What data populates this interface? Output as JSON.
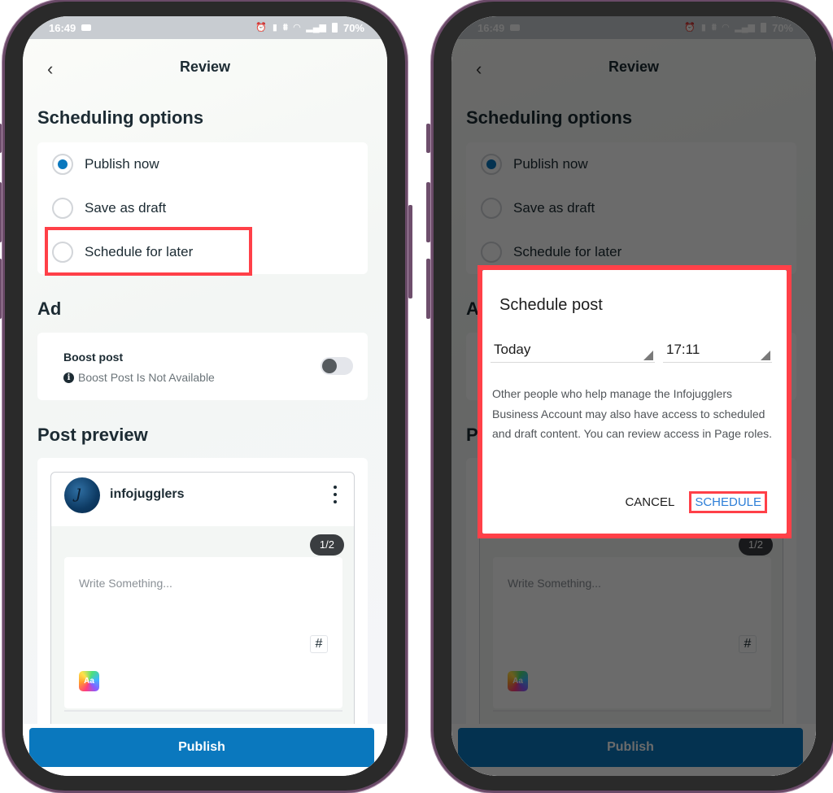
{
  "status_bar": {
    "time": "16:49",
    "battery": "70%",
    "icons": [
      "gallery-icon",
      "alarm-icon",
      "vibrate-icon",
      "volte-icon",
      "wifi-icon",
      "signal-icon",
      "battery-icon"
    ]
  },
  "header": {
    "back_icon": "chevron-left-icon",
    "title": "Review"
  },
  "scheduling": {
    "title": "Scheduling options",
    "options": [
      {
        "label": "Publish now",
        "selected": true
      },
      {
        "label": "Save as draft",
        "selected": false
      },
      {
        "label": "Schedule for later",
        "selected": false
      }
    ]
  },
  "ad": {
    "title": "Ad",
    "boost_title": "Boost post",
    "boost_subtitle": "Boost Post Is Not Available",
    "boost_enabled": false
  },
  "preview": {
    "title": "Post preview",
    "account_name": "infojugglers",
    "page_indicator": "1/2",
    "compose_placeholder": "Write Something...",
    "hashtag_label": "#",
    "text_style_label": "Aa"
  },
  "footer": {
    "publish_label": "Publish"
  },
  "dialog": {
    "title": "Schedule post",
    "date_value": "Today",
    "time_value": "17:11",
    "body": "Other people who help manage the Infojugglers Business Account may also have access to scheduled and draft content. You can review access in Page roles.",
    "cancel_label": "CANCEL",
    "schedule_label": "SCHEDULE"
  },
  "colors": {
    "accent": "#0a78be",
    "highlight": "#ff4048",
    "dialog_link": "#2e7fd8",
    "frame": "#6a4a68"
  }
}
